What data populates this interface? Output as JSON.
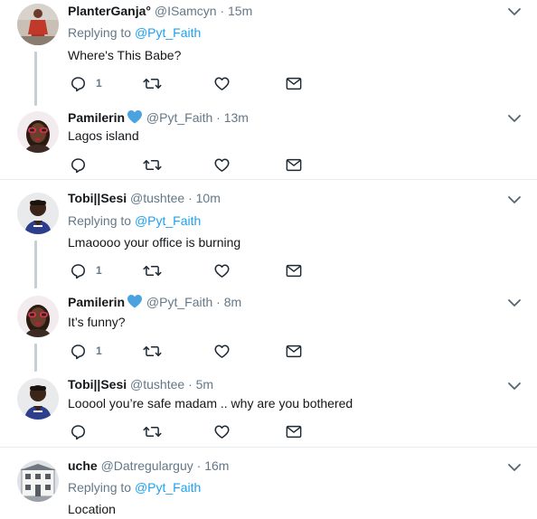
{
  "colors": {
    "link": "#1da1f2",
    "secondary": "#657786",
    "text": "#14171a",
    "divider": "#e6ecf0",
    "verified": "#4aa3df"
  },
  "tweets": [
    {
      "name": "PlanterGanja°",
      "handle": "@ISamcyn",
      "dot": "·",
      "time": "15m",
      "replying_prefix": "Replying to",
      "mention": "@Pyt_Faith",
      "text": "Where's This Babe?",
      "reply_count": "1",
      "avatar_icon": "avatar-red-outfit"
    },
    {
      "name": "Pamilerin",
      "handle": "@Pyt_Faith",
      "dot": "·",
      "time": "13m",
      "text": "Lagos island",
      "reply_count": "",
      "avatar_icon": "avatar-woman-red-glasses"
    },
    {
      "name": "Tobi||Sesi",
      "handle": "@tushtee",
      "dot": "·",
      "time": "10m",
      "replying_prefix": "Replying to",
      "mention": "@Pyt_Faith",
      "text": "Lmaoooo your office is burning",
      "reply_count": "1",
      "avatar_icon": "avatar-man-blue-shirt"
    },
    {
      "name": "Pamilerin",
      "handle": "@Pyt_Faith",
      "dot": "·",
      "time": "8m",
      "text": "It’s funny?",
      "reply_count": "1",
      "avatar_icon": "avatar-woman-red-glasses"
    },
    {
      "name": "Tobi||Sesi",
      "handle": "@tushtee",
      "dot": "·",
      "time": "5m",
      "text": "Looool you’re safe madam .. why are you bothered",
      "reply_count": "",
      "avatar_icon": "avatar-man-blue-shirt"
    },
    {
      "name": "uche",
      "handle": "@Datregularguy",
      "dot": "·",
      "time": "16m",
      "replying_prefix": "Replying to",
      "mention": "@Pyt_Faith",
      "text": "Location",
      "reply_count": "",
      "avatar_icon": "avatar-building"
    }
  ]
}
